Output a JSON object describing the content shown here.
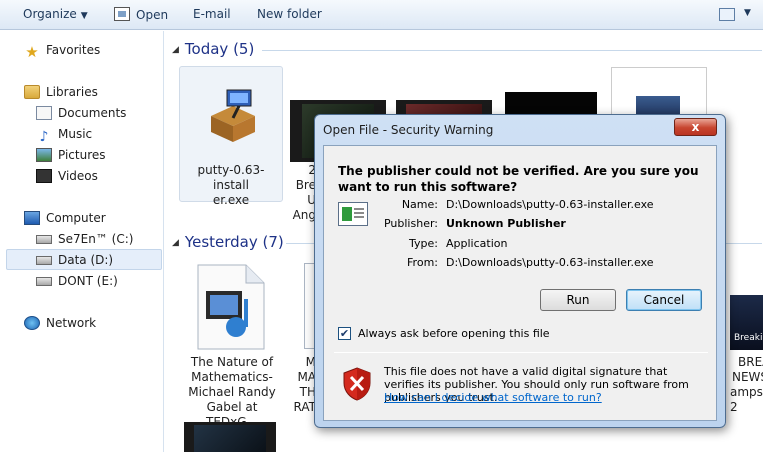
{
  "toolbar": {
    "organize": "Organize",
    "open": "Open",
    "email": "E-mail",
    "new_folder": "New folder",
    "help": "?"
  },
  "nav": {
    "favorites": "Favorites",
    "libraries": "Libraries",
    "documents": "Documents",
    "music": "Music",
    "pictures": "Pictures",
    "videos": "Videos",
    "computer": "Computer",
    "drive_c": "Se7En™ (C:)",
    "drive_d": "Data (D:)",
    "drive_e": "DONT (E:)",
    "network": "Network"
  },
  "content": {
    "group_today": "Today (5)",
    "group_yesterday": "Yesterday (7)",
    "putty_label_1": "putty-0.63-install",
    "putty_label_2": "er.exe",
    "video1_lines": [
      "2",
      "Bre",
      "U",
      "Ang"
    ],
    "nature_label": [
      "The Nature of",
      "Mathematics-",
      "Michael Randy",
      "Gabel at TEDxG..."
    ],
    "partial_label": [
      "M",
      "MA",
      "TH",
      "RAT"
    ],
    "right_label": [
      "BREA",
      "NEWS",
      "amps 2"
    ],
    "right_thumb_text": "Breakin"
  },
  "dialog": {
    "title": "Open File - Security Warning",
    "close": "x",
    "question": "The publisher could not be verified.  Are you sure you want to run this software?",
    "fields": [
      {
        "label": "Name:",
        "value": "D:\\Downloads\\putty-0.63-installer.exe"
      },
      {
        "label": "Publisher:",
        "value": "Unknown Publisher"
      },
      {
        "label": "Type:",
        "value": "Application"
      },
      {
        "label": "From:",
        "value": "D:\\Downloads\\putty-0.63-installer.exe"
      }
    ],
    "run": "Run",
    "cancel": "Cancel",
    "checkbox_checked": true,
    "checkbox_mark": "✔",
    "checkbox_label": "Always ask before opening this file",
    "warning": "This file does not have a valid digital signature that verifies its publisher.  You should only run software from publishers you trust.",
    "link": "How can I decide what software to run?"
  },
  "colors": {
    "group_heading": "#1e3287",
    "link": "#0066cc",
    "close_button": "#c7452f"
  }
}
